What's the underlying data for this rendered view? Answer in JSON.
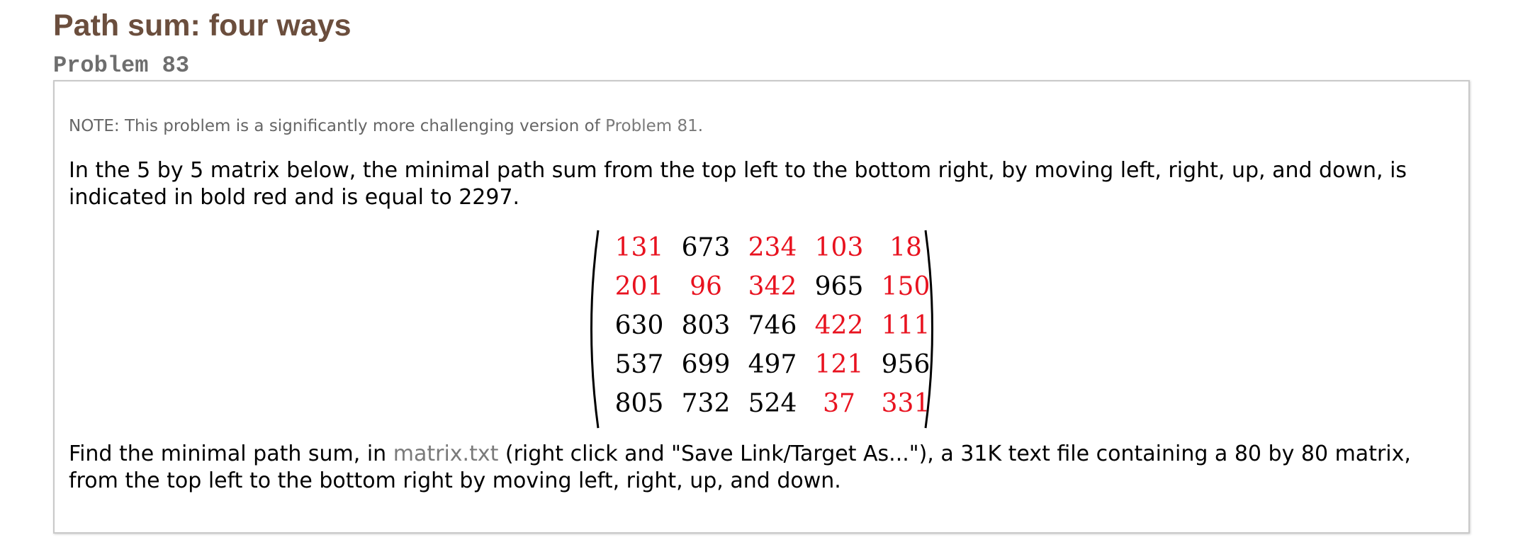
{
  "header": {
    "title": "Path sum: four ways",
    "problem_label": "Problem 83"
  },
  "note": {
    "prefix": "NOTE: This problem is a significantly more challenging version of ",
    "link_text": "Problem 81",
    "suffix": "."
  },
  "intro": {
    "text": "In the 5 by 5 matrix below, the minimal path sum from the top left to the bottom right, by moving left, right, up, and down, is indicated in bold red and is equal to 2297."
  },
  "matrix": {
    "rows": [
      [
        131,
        673,
        234,
        103,
        18
      ],
      [
        201,
        96,
        342,
        965,
        150
      ],
      [
        630,
        803,
        746,
        422,
        111
      ],
      [
        537,
        699,
        497,
        121,
        956
      ],
      [
        805,
        732,
        524,
        37,
        331
      ]
    ],
    "highlight": [
      [
        true,
        false,
        true,
        true,
        true
      ],
      [
        true,
        true,
        true,
        false,
        true
      ],
      [
        false,
        false,
        false,
        true,
        true
      ],
      [
        false,
        false,
        false,
        true,
        false
      ],
      [
        false,
        false,
        false,
        true,
        true
      ]
    ],
    "highlight_color": "#e8121f",
    "normal_color": "#000000"
  },
  "task": {
    "prefix": "Find the minimal path sum, in ",
    "link_text": "matrix.txt",
    "suffix": " (right click and \"Save Link/Target As...\"), a 31K text file containing a 80 by 80 matrix, from the top left to the bottom right by moving left, right, up, and down."
  },
  "colors": {
    "title": "#6b4e3d",
    "problem_label": "#6e6e6e",
    "link": "#7a7a7a",
    "box_border": "#c9c9c9"
  }
}
